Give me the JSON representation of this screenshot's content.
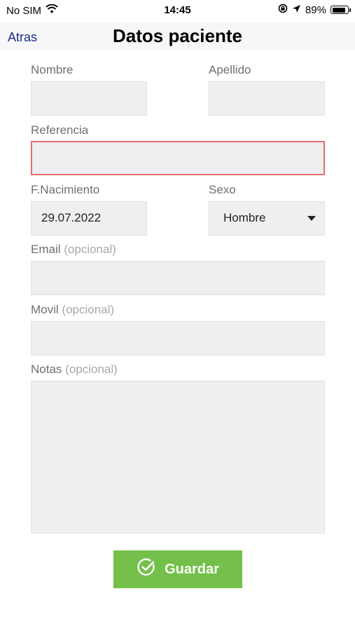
{
  "status_bar": {
    "carrier": "No SIM",
    "time": "14:45",
    "battery": "89%",
    "battery_level": 0.89,
    "icons": [
      "wifi-icon",
      "lock-rotation-icon",
      "location-icon",
      "battery-icon"
    ]
  },
  "nav": {
    "back_label": "Atras",
    "title": "Datos paciente"
  },
  "form": {
    "nombre": {
      "label": "Nombre",
      "value": ""
    },
    "apellido": {
      "label": "Apellido",
      "value": ""
    },
    "referencia": {
      "label": "Referencia",
      "value": "",
      "state": "error"
    },
    "nacimiento": {
      "label": "F.Nacimiento",
      "value": "29.07.2022"
    },
    "sexo": {
      "label": "Sexo",
      "value": "Hombre"
    },
    "email": {
      "label": "Email",
      "optional": "(opcional)",
      "value": ""
    },
    "movil": {
      "label": "Movil",
      "optional": "(opcional)",
      "value": ""
    },
    "notas": {
      "label": "Notas",
      "optional": "(opcional)",
      "value": ""
    }
  },
  "save_button": {
    "label": "Guardar",
    "icon": "check-circle-icon"
  },
  "colors": {
    "accent_green": "#74c04a",
    "error_border": "#e46c72",
    "link_blue": "#1a2a8a",
    "field_bg": "#efefef"
  }
}
